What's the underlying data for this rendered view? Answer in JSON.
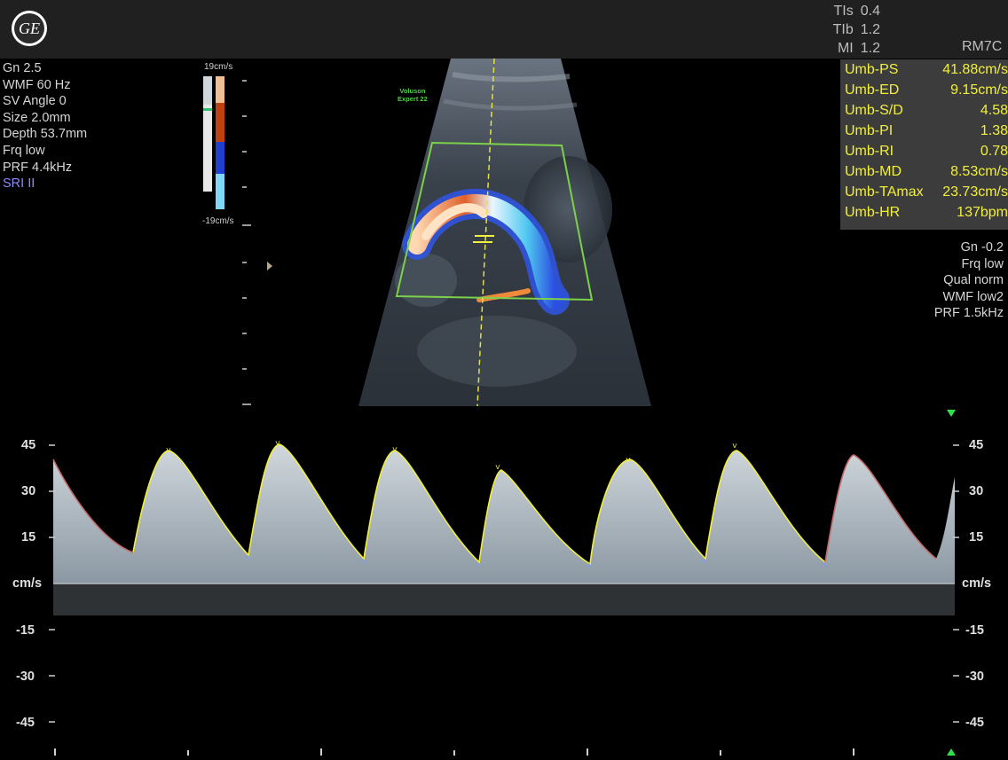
{
  "header": {
    "logo_text": "GE",
    "safety": [
      {
        "label": "TIs",
        "value": "0.4"
      },
      {
        "label": "TIb",
        "value": "1.2"
      },
      {
        "label": "MI",
        "value": "1.2"
      }
    ],
    "probe": "RM7C"
  },
  "left_params": [
    "Gn  2.5",
    "WMF 60 Hz",
    "SV Angle  0",
    "Size  2.0mm",
    "Depth 53.7mm",
    "Frq low",
    "PRF  4.4kHz"
  ],
  "sri_label": "SRI II",
  "color_scale": {
    "top": "19cm/s",
    "bottom": "-19cm/s"
  },
  "image_label": {
    "line1": "Voluson",
    "line2": "Expert 22"
  },
  "measurements": [
    {
      "label": "Umb-PS",
      "value": "41.88cm/s"
    },
    {
      "label": "Umb-ED",
      "value": "9.15cm/s"
    },
    {
      "label": "Umb-S/D",
      "value": "4.58"
    },
    {
      "label": "Umb-PI",
      "value": "1.38"
    },
    {
      "label": "Umb-RI",
      "value": "0.78"
    },
    {
      "label": "Umb-MD",
      "value": "8.53cm/s"
    },
    {
      "label": "Umb-TAmax",
      "value": "23.73cm/s"
    },
    {
      "label": "Umb-HR",
      "value": "137bpm"
    }
  ],
  "right_params": [
    "Gn -0.2",
    "Frq low",
    "Qual norm",
    "WMF low2",
    "PRF  1.5kHz"
  ],
  "doppler_axis": {
    "ticks": [
      "45",
      "30",
      "15",
      "cm/s",
      "-15",
      "-30",
      "-45"
    ],
    "values": [
      45,
      30,
      15,
      0,
      -15,
      -30,
      -45
    ]
  },
  "colors": {
    "accent_yellow": "#f2ef3a",
    "roi_green": "#7cd04a",
    "trace_red": "#c46a6a"
  }
}
